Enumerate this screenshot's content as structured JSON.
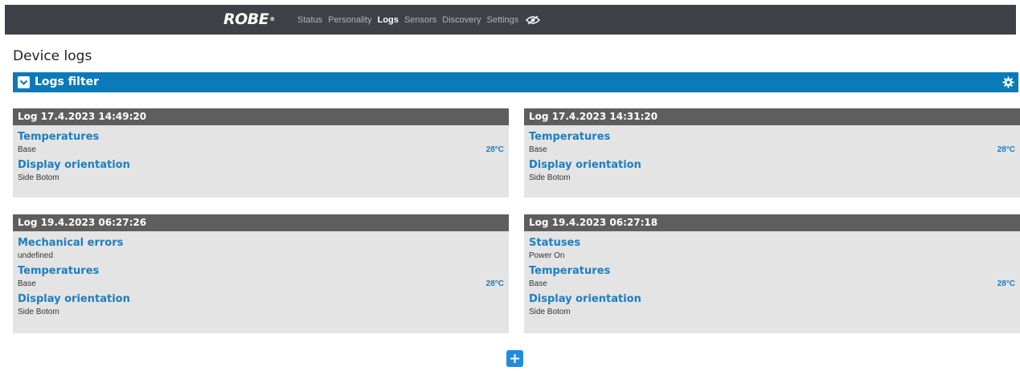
{
  "brand": {
    "logo": "ROBE",
    "mark": "®"
  },
  "nav": [
    {
      "label": "Status"
    },
    {
      "label": "Personality"
    },
    {
      "label": "Logs",
      "active": true
    },
    {
      "label": "Sensors"
    },
    {
      "label": "Discovery"
    },
    {
      "label": "Settings"
    }
  ],
  "page_title": "Device logs",
  "filter": {
    "label": "Logs filter"
  },
  "logs": [
    {
      "title": "Log 17.4.2023 14:49:20",
      "sections": [
        {
          "heading": "Temperatures",
          "rows": [
            {
              "label": "Base",
              "value": "28°C"
            }
          ]
        },
        {
          "heading": "Display orientation",
          "rows": [
            {
              "label": "Side Botom",
              "value": ""
            }
          ]
        }
      ]
    },
    {
      "title": "Log 17.4.2023 14:31:20",
      "sections": [
        {
          "heading": "Temperatures",
          "rows": [
            {
              "label": "Base",
              "value": "28°C"
            }
          ]
        },
        {
          "heading": "Display orientation",
          "rows": [
            {
              "label": "Side Botom",
              "value": ""
            }
          ]
        }
      ]
    },
    {
      "title": "Log 19.4.2023 06:27:26",
      "sections": [
        {
          "heading": "Mechanical errors",
          "rows": [
            {
              "label": "undefined",
              "value": ""
            }
          ]
        },
        {
          "heading": "Temperatures",
          "rows": [
            {
              "label": "Base",
              "value": "28°C"
            }
          ]
        },
        {
          "heading": "Display orientation",
          "rows": [
            {
              "label": "Side Botom",
              "value": ""
            }
          ]
        }
      ]
    },
    {
      "title": "Log 19.4.2023 06:27:18",
      "sections": [
        {
          "heading": "Statuses",
          "rows": [
            {
              "label": "Power On",
              "value": ""
            }
          ]
        },
        {
          "heading": "Temperatures",
          "rows": [
            {
              "label": "Base",
              "value": "28°C"
            }
          ]
        },
        {
          "heading": "Display orientation",
          "rows": [
            {
              "label": "Side Botom",
              "value": ""
            }
          ]
        }
      ]
    }
  ],
  "icons": {
    "eye": "eye-slash-icon",
    "gear": "gear-icon",
    "toggle": "chevron-down-icon",
    "add": "plus-icon"
  },
  "colors": {
    "topbar": "#3e4147",
    "accent": "#0a7bb8",
    "card_header": "#5e5e5e",
    "card_bg": "#e4e4e4",
    "link": "#1b7fc1"
  }
}
